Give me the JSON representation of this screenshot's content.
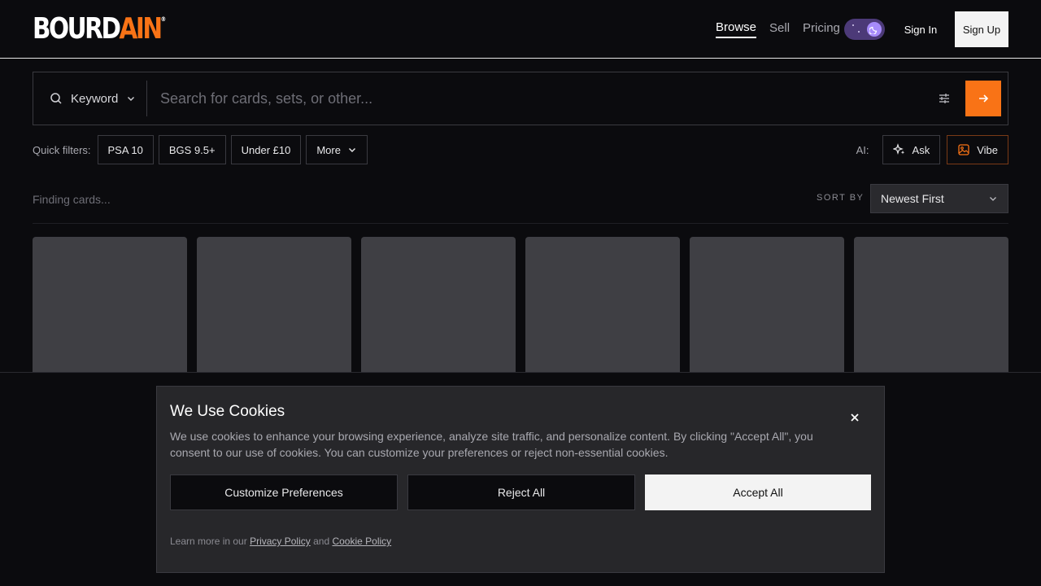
{
  "brand": {
    "logo_main": "BOURD",
    "logo_accent": "AIN",
    "logo_mark": "®",
    "accent_color": "#f97316"
  },
  "nav": {
    "browse": "Browse",
    "sell": "Sell",
    "pricing": "Pricing"
  },
  "auth": {
    "sign_in": "Sign In",
    "sign_up": "Sign Up"
  },
  "search": {
    "type_label": "Keyword",
    "placeholder": "Search for cards, sets, or other..."
  },
  "quick_filters": {
    "label": "Quick filters:",
    "chips": [
      "PSA 10",
      "BGS 9.5+",
      "Under £10"
    ],
    "more": "More"
  },
  "ai": {
    "label": "AI:",
    "ask": "Ask",
    "vibe": "Vibe"
  },
  "results": {
    "status": "Finding cards...",
    "sort_label": "SORT BY",
    "sort_value": "Newest First"
  },
  "cookie": {
    "title": "We Use Cookies",
    "text": "We use cookies to enhance your browsing experience, analyze site traffic, and personalize content. By clicking \"Accept All\", you consent to our use of cookies. You can customize your preferences or reject non-essential cookies.",
    "customize": "Customize Preferences",
    "reject": "Reject All",
    "accept": "Accept All",
    "learn_more": "Learn more in our",
    "privacy": "Privacy Policy",
    "and": "and",
    "cookie_policy": "Cookie Policy"
  }
}
